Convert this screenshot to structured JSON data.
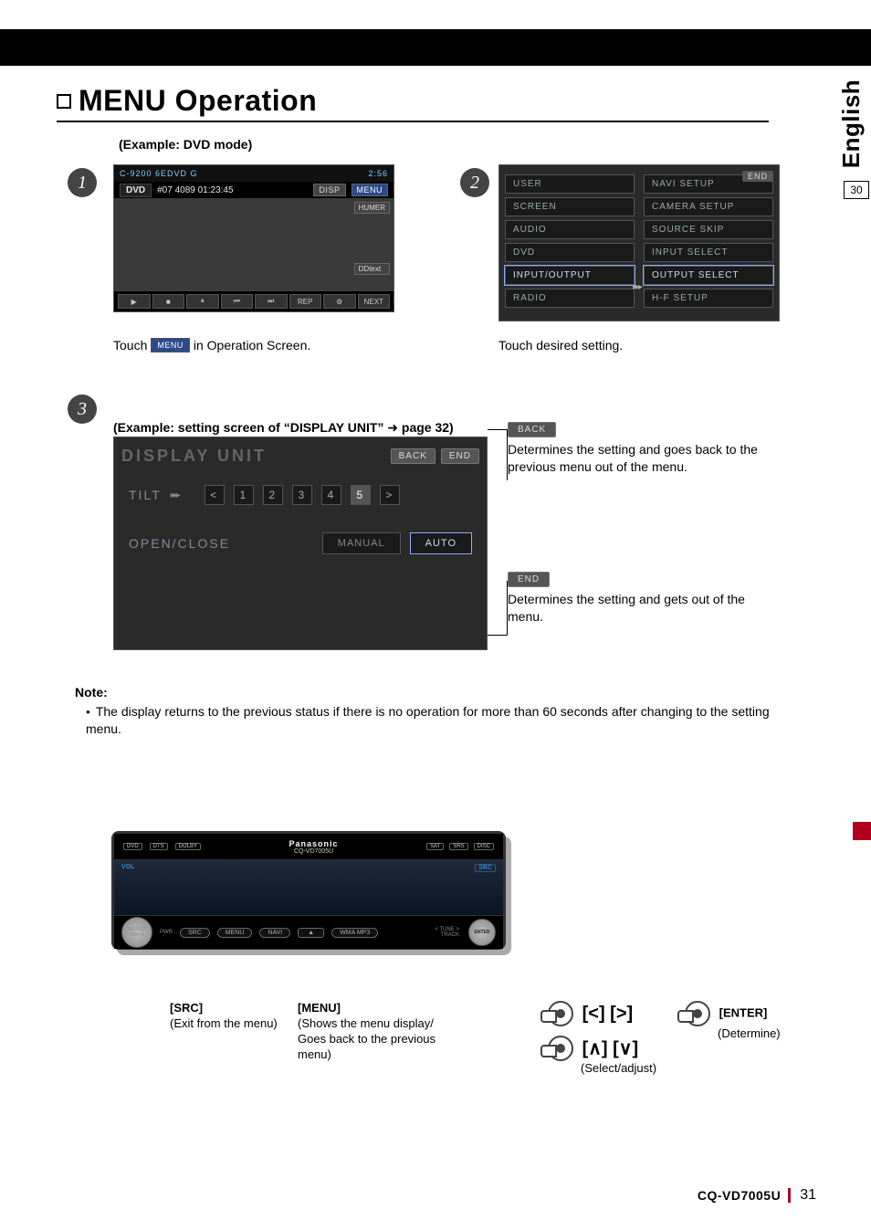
{
  "language_tab": "English",
  "side_box": "30",
  "title": "MENU Operation",
  "example_mode": "(Example: DVD mode)",
  "step1": {
    "statusbar_left": "C-9200 6EDVD G",
    "statusbar_right": "2:56",
    "info": {
      "mode": "DVD",
      "track": "#07 4089 01:23:45",
      "disp": "DISP",
      "menu": "MENU"
    },
    "side_labels": {
      "humer": "HUMER",
      "ddtext": "DDtext"
    },
    "controls": [
      "▶",
      "■",
      "⏸",
      "⏮",
      "⏭",
      "REP",
      "⚙",
      "NEXT"
    ],
    "caption_pre": "Touch",
    "caption_chip": "MENU",
    "caption_post": "in Operation Screen."
  },
  "step2": {
    "end_chip": "END",
    "left_col": [
      "USER",
      "SCREEN",
      "AUDIO",
      "DVD",
      "INPUT/OUTPUT",
      "RADIO"
    ],
    "right_col": [
      "NAVI SETUP",
      "CAMERA SETUP",
      "SOURCE SKIP",
      "INPUT SELECT",
      "OUTPUT SELECT",
      "H-F SETUP"
    ],
    "selected_left_index": 4,
    "selected_right_index": 4,
    "arrow": "▸▸▸",
    "caption": "Touch desired setting."
  },
  "step3": {
    "title_pre": "(Example: setting screen of “DISPLAY UNIT” ",
    "title_arrow": "➜",
    "title_post": " page 32)",
    "hdr_title": "DISPLAY UNIT",
    "back": "BACK",
    "end": "END",
    "row1_label": "TILT",
    "row1_arrows": "▸▸▸",
    "steps": [
      "1",
      "2",
      "3",
      "4",
      "5"
    ],
    "active_step_index": 4,
    "nav_left": "<",
    "nav_right": ">",
    "row2_label": "OPEN/CLOSE",
    "mode1": "MANUAL",
    "mode2": "AUTO"
  },
  "back_explain": "Determines the setting and goes back to the previous menu out of the menu.",
  "end_explain": "Determines the setting and gets out of the menu.",
  "note": {
    "heading": "Note:",
    "items": [
      "The display returns to the previous status if there is no operation for more than 60 seconds after changing to the setting menu."
    ]
  },
  "unit": {
    "brand": "Panasonic",
    "model": "CQ-VD7005U",
    "left_logos": [
      "DVD",
      "DTS",
      "DOLBY"
    ],
    "right_logos": [
      "SAT",
      "SRS",
      "DISC"
    ],
    "screen_vol": "VOL",
    "screen_src": "SRC",
    "knob_big_top": "ADJUST",
    "knob_big_bottom": "50W×4",
    "pwr": "PWR",
    "face_buttons": [
      "SRC",
      "MENU",
      "NAVI",
      "▲",
      "WMA MP3"
    ],
    "track_labels": [
      "< TUNE >",
      "TRACK"
    ],
    "enter": "ENTER"
  },
  "legend": {
    "src_h": "[SRC]",
    "src_t": "(Exit from the menu)",
    "menu_h": "[MENU]",
    "menu_t": "(Shows the menu display/ Goes back to the previous menu)",
    "lr": "[<] [>]",
    "ud": "[∧] [∨]",
    "sel_t": "(Select/adjust)",
    "enter_h": "[ENTER]",
    "enter_t": "(Determine)"
  },
  "footer_model": "CQ-VD7005U",
  "footer_page": "31"
}
